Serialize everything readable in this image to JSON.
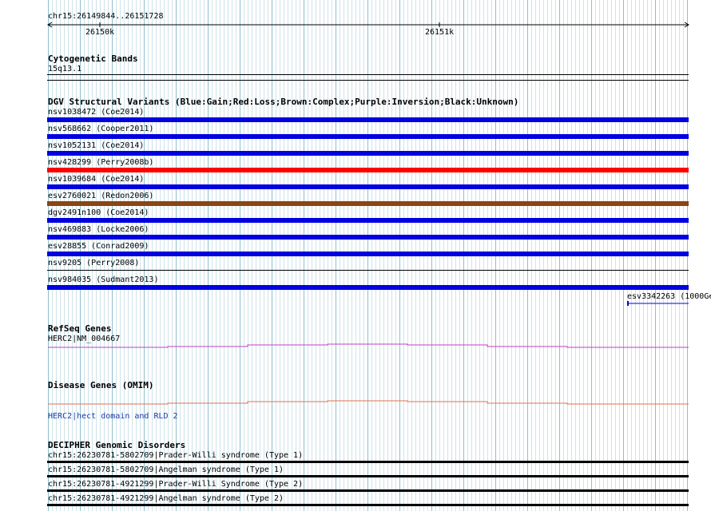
{
  "ruler": {
    "position": "chr15:26149844..26151728",
    "tick_left": "26150k",
    "tick_right": "26151k"
  },
  "cyto": {
    "title": "Cytogenetic Bands",
    "band": "15q13.1"
  },
  "dgv": {
    "title": "DGV Structural Variants (Blue:Gain;Red:Loss;Brown:Complex;Purple:Inversion;Black:Unknown)",
    "variants": [
      {
        "label": "nsv1038472 (Coe2014)",
        "color": "#0000e0"
      },
      {
        "label": "nsv568662 (Cooper2011)",
        "color": "#0000e0"
      },
      {
        "label": "nsv1052131 (Coe2014)",
        "color": "#0000e0"
      },
      {
        "label": "nsv428299 (Perry2008b)",
        "color": "#ff0000"
      },
      {
        "label": "nsv1039684 (Coe2014)",
        "color": "#0000e0"
      },
      {
        "label": "esv2760021 (Redon2006)",
        "color": "#8b4513"
      },
      {
        "label": "dgv2491n100 (Coe2014)",
        "color": "#0000e0"
      },
      {
        "label": "nsv469883 (Locke2006)",
        "color": "#0000e0"
      },
      {
        "label": "esv28855 (Conrad2009)",
        "color": "#0000e0"
      },
      {
        "label": "nsv9205 (Perry2008)",
        "color": "#000000"
      },
      {
        "label": "nsv984035 (Sudmant2013)",
        "color": "#0000e0"
      }
    ],
    "extra_label": "esv3342263 (1000Ge"
  },
  "refseq": {
    "title": "RefSeq Genes",
    "gene": "HERC2|NM_004667",
    "color": "#c040c0"
  },
  "omim": {
    "title": "Disease Genes (OMIM)",
    "gene": "HERC2|hect domain and RLD 2",
    "color": "#e07050"
  },
  "decipher": {
    "title": "DECIPHER Genomic Disorders",
    "items": [
      {
        "label": "chr15:26230781-5802709|Prader-Willi syndrome (Type 1)"
      },
      {
        "label": "chr15:26230781-5802709|Angelman syndrome (Type 1)"
      },
      {
        "label": "chr15:26230781-4921299|Prader-Willi Syndrome (Type 2)"
      },
      {
        "label": "chr15:26230781-4921299|Angelman syndrome (Type 2)"
      }
    ]
  }
}
